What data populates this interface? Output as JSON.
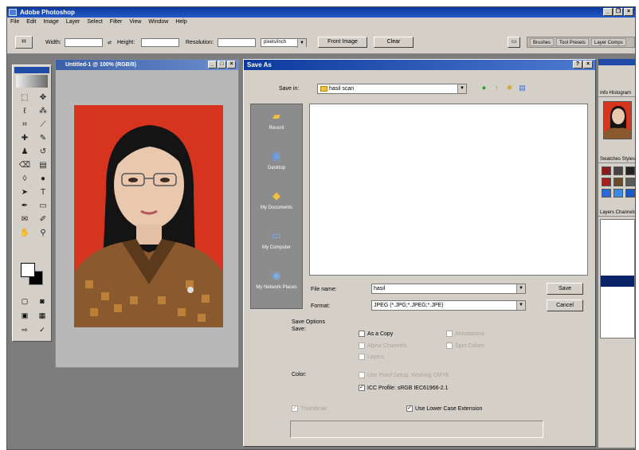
{
  "app": {
    "title": "Adobe Photoshop"
  },
  "menu": [
    "File",
    "Edit",
    "Image",
    "Layer",
    "Select",
    "Filter",
    "View",
    "Window",
    "Help"
  ],
  "options_bar": {
    "width_label": "Width:",
    "height_label": "Height:",
    "resolution_label": "Resolution:",
    "resolution_unit": "pixels/inch",
    "front_image_button": "Front Image",
    "clear_button": "Clear",
    "palette_tabs": [
      "Brushes",
      "Tool Presets",
      "Layer Comps"
    ]
  },
  "document": {
    "title": "Untitled-1 @ 100% (RGB/8)"
  },
  "save_dialog": {
    "title": "Save As",
    "save_in_label": "Save in:",
    "save_in_value": "hasil scan",
    "places": [
      "Recent",
      "Desktop",
      "My Documents",
      "My Computer",
      "My Network Places"
    ],
    "file_name_label": "File name:",
    "file_name_value": "hasil",
    "format_label": "Format:",
    "format_value": "JPEG (*.JPG;*.JPEG;*.JPE)",
    "save_button": "Save",
    "cancel_button": "Cancel",
    "save_options_label": "Save Options",
    "save_label": "Save:",
    "options": {
      "as_a_copy": "As a Copy",
      "annotations": "Annotations",
      "alpha_channels": "Alpha Channels",
      "spot_colors": "Spot Colors",
      "layers": "Layers"
    },
    "color_label": "Color:",
    "use_proof_setup": "Use Proof Setup:  Working CMYK",
    "icc_profile": "ICC Profile:  sRGB IEC61966-2.1",
    "thumbnail": "Thumbnail",
    "lower_case": "Use Lower Case Extension"
  },
  "right_panels": {
    "tabs_top": "Info  Histogram",
    "tabs_mid": "Swatches  Styles",
    "tabs_layers": "Layers  Channels"
  },
  "colors": {
    "photo_background": "#d6341f",
    "titlebar_blue": "#0b3a9e"
  }
}
